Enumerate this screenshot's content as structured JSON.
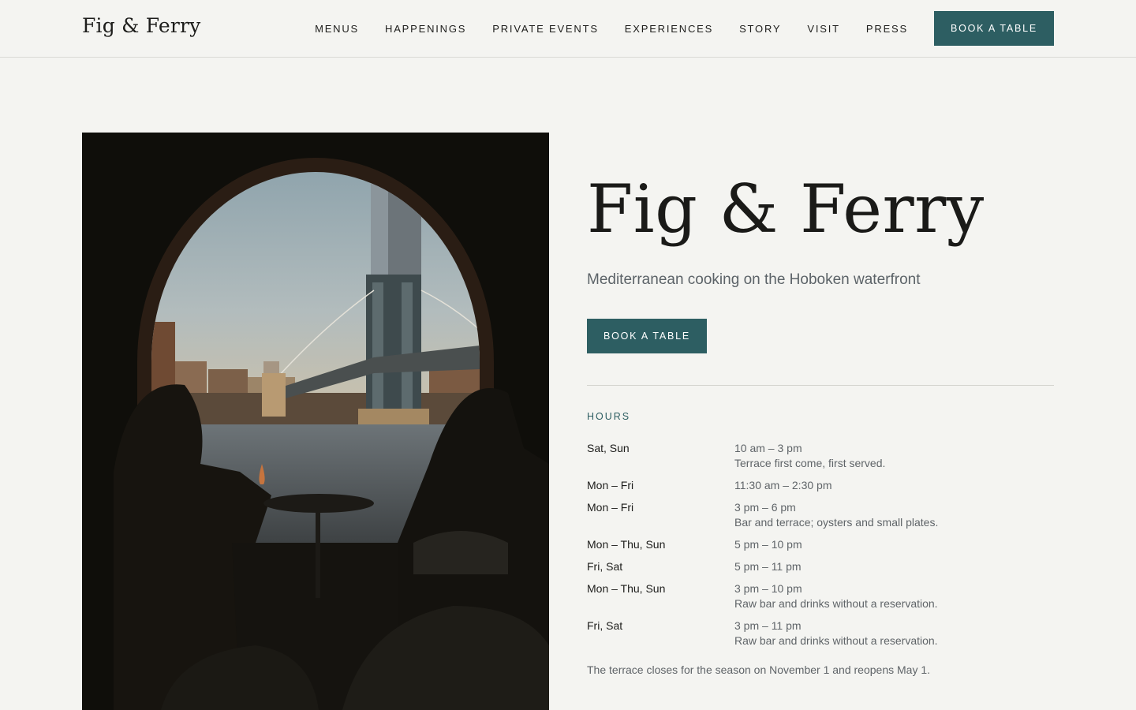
{
  "header": {
    "logo": "Fig & Ferry",
    "nav": [
      {
        "label": "MENUS"
      },
      {
        "label": "HAPPENINGS"
      },
      {
        "label": "PRIVATE EVENTS"
      },
      {
        "label": "EXPERIENCES"
      },
      {
        "label": "STORY"
      },
      {
        "label": "VISIT"
      },
      {
        "label": "PRESS"
      }
    ],
    "cta": "BOOK A TABLE"
  },
  "hero": {
    "title": "Fig & Ferry",
    "subtitle": "Mediterranean cooking on the Hoboken waterfront",
    "cta": "BOOK A TABLE"
  },
  "hours": {
    "label": "HOURS",
    "rows": [
      {
        "day": "Sat, Sun",
        "time": "10 am – 3 pm",
        "note": "Terrace first come, first served."
      },
      {
        "day": "Mon – Fri",
        "time": "11:30 am – 2:30 pm",
        "note": ""
      },
      {
        "day": "Mon – Fri",
        "time": "3 pm – 6 pm",
        "note": "Bar and terrace; oysters and small plates."
      },
      {
        "day": "Mon – Thu, Sun",
        "time": "5 pm – 10 pm",
        "note": ""
      },
      {
        "day": "Fri, Sat",
        "time": "5 pm – 11 pm",
        "note": ""
      },
      {
        "day": "Mon – Thu, Sun",
        "time": "3 pm – 10 pm",
        "note": "Raw bar and drinks without a reservation."
      },
      {
        "day": "Fri, Sat",
        "time": "3 pm – 11 pm",
        "note": "Raw bar and drinks without a reservation."
      }
    ],
    "footnote": "The terrace closes for the season on November 1 and reopens May 1."
  },
  "colors": {
    "accent": "#2d5e62",
    "background": "#f4f4f1",
    "text": "#1d1d1b",
    "muted": "#5f6468"
  }
}
